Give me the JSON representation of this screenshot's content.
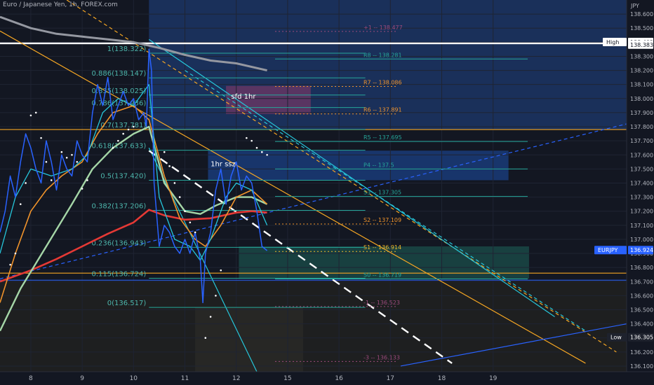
{
  "header": {
    "title": "Euro / Japanese Yen, 1h, FOREX.com"
  },
  "chart_data": {
    "type": "line",
    "axis": {
      "currency": "JPY",
      "y_ticks": [
        138.6,
        138.5,
        138.4,
        138.3,
        138.2,
        138.1,
        138.0,
        137.9,
        137.8,
        137.7,
        137.6,
        137.5,
        137.4,
        137.3,
        137.2,
        137.1,
        137.0,
        136.9,
        136.8,
        136.7,
        136.6,
        136.5,
        136.4,
        136.3,
        136.2,
        136.1
      ],
      "ylim": [
        136.06,
        138.7
      ],
      "x_ticks": [
        "8",
        "9",
        "10",
        "11",
        "12",
        "15",
        "16",
        "17",
        "18",
        "19"
      ],
      "xlim": [
        7.4,
        19.6
      ]
    },
    "markers": [
      {
        "label": "High",
        "value": "138.402",
        "y": 138.402,
        "color": "#ffffff",
        "text_color": "#131722"
      },
      {
        "label": "",
        "value": "138.383",
        "y": 138.383,
        "color": "#ffffff",
        "text_color": "#131722"
      },
      {
        "label": "EURJPY",
        "value": "136.924",
        "y": 136.924,
        "color": "#2962ff",
        "text_color": "#ffffff"
      },
      {
        "label": "Low",
        "value": "136.305",
        "y": 136.305,
        "color": "#1e222d",
        "text_color": "#ffffff"
      }
    ],
    "fib": {
      "x_start": 10.3,
      "x_end": 12.6,
      "levels": [
        {
          "ratio": "1",
          "price": "138.322",
          "y": 138.322
        },
        {
          "ratio": "0.886",
          "price": "138.147",
          "y": 138.147
        },
        {
          "ratio": "0.835",
          "price": "138.025",
          "y": 138.025
        },
        {
          "ratio": "0.786",
          "price": "137.936",
          "y": 137.936
        },
        {
          "ratio": "0.7",
          "price": "137.781",
          "y": 137.781
        },
        {
          "ratio": "0.618",
          "price": "137.633",
          "y": 137.633
        },
        {
          "ratio": "0.5",
          "price": "137.420",
          "y": 137.42
        },
        {
          "ratio": "0.382",
          "price": "137.206",
          "y": 137.206
        },
        {
          "ratio": "0.236",
          "price": "136.943",
          "y": 136.943
        },
        {
          "ratio": "0.115",
          "price": "136.724",
          "y": 136.724
        },
        {
          "ratio": "0",
          "price": "136.517",
          "y": 136.517
        }
      ]
    },
    "pivots": [
      {
        "label": "+1",
        "price": "138.477",
        "y": 138.477,
        "color": "#9c4a7c",
        "style": "dotted"
      },
      {
        "label": "R8",
        "price": "138.281",
        "y": 138.281,
        "color": "#26a69a",
        "style": "solid"
      },
      {
        "label": "R7",
        "price": "138.086",
        "y": 138.086,
        "color": "#f0932b",
        "style": "dotted"
      },
      {
        "label": "R6",
        "price": "137.891",
        "y": 137.891,
        "color": "#f0932b",
        "style": "dotted"
      },
      {
        "label": "R5",
        "price": "137.695",
        "y": 137.695,
        "color": "#26a69a",
        "style": "solid"
      },
      {
        "label": "P4",
        "price": "137.5",
        "y": 137.5,
        "color": "#26a69a",
        "style": "solid"
      },
      {
        "label": "S3",
        "price": "137.305",
        "y": 137.305,
        "color": "#26a69a",
        "style": "solid"
      },
      {
        "label": "S2",
        "price": "137.109",
        "y": 137.109,
        "color": "#f0932b",
        "style": "dotted"
      },
      {
        "label": "S1",
        "price": "136.914",
        "y": 136.914,
        "color": "#f0b429",
        "style": "dotted"
      },
      {
        "label": "S0",
        "price": "136.719",
        "y": 136.719,
        "color": "#26a69a",
        "style": "solid"
      },
      {
        "label": "-1",
        "price": "136.523",
        "y": 136.523,
        "color": "#9c4a7c",
        "style": "dotted"
      },
      {
        "label": "-3",
        "price": "136.133",
        "y": 136.133,
        "color": "#9c4a7c",
        "style": "dotted"
      }
    ],
    "annotations": [
      {
        "text": "sfd 1hr",
        "x": 11.9,
        "y": 138.0
      },
      {
        "text": "1hr ssz",
        "x": 11.5,
        "y": 137.52
      }
    ],
    "price_series": {
      "name": "",
      "color": "#2962ff",
      "x": [
        7.4,
        7.5,
        7.6,
        7.7,
        7.8,
        7.9,
        8.0,
        8.1,
        8.2,
        8.3,
        8.4,
        8.5,
        8.6,
        8.7,
        8.8,
        8.9,
        9.0,
        9.1,
        9.2,
        9.3,
        9.4,
        9.5,
        9.6,
        9.7,
        9.8,
        9.9,
        10.0,
        10.1,
        10.2,
        10.25,
        10.3,
        10.35,
        10.4,
        10.5,
        10.6,
        10.7,
        10.8,
        10.9,
        11.0,
        11.1,
        11.2,
        11.3,
        11.35,
        11.4,
        11.5,
        11.6,
        11.7,
        11.8,
        11.9,
        12.0,
        12.1,
        12.2,
        12.3,
        12.4,
        12.5,
        12.6
      ],
      "y": [
        137.05,
        137.2,
        137.45,
        137.3,
        137.55,
        137.75,
        137.65,
        137.5,
        137.4,
        137.7,
        137.55,
        137.35,
        137.6,
        137.5,
        137.45,
        137.7,
        137.6,
        137.55,
        137.9,
        138.1,
        137.95,
        138.15,
        137.85,
        137.95,
        138.05,
        137.95,
        138.0,
        137.85,
        137.9,
        137.8,
        138.35,
        138.2,
        137.4,
        136.95,
        137.1,
        137.05,
        136.95,
        136.9,
        137.0,
        136.9,
        137.05,
        136.85,
        136.55,
        136.9,
        137.05,
        137.35,
        137.5,
        137.25,
        137.45,
        137.55,
        137.35,
        137.45,
        137.4,
        137.2,
        136.95,
        136.92
      ]
    },
    "ema_slow": {
      "color": "#e53935",
      "x": [
        7.4,
        8.0,
        8.5,
        9.0,
        9.5,
        10.0,
        10.3,
        10.6,
        11.0,
        11.5,
        12.0,
        12.3,
        12.6
      ],
      "y": [
        136.7,
        136.78,
        136.86,
        136.95,
        137.04,
        137.12,
        137.21,
        137.17,
        137.14,
        137.15,
        137.19,
        137.2,
        137.19
      ]
    },
    "ema_mid": {
      "color": "#a5d6a7",
      "x": [
        7.4,
        7.8,
        8.3,
        8.8,
        9.2,
        9.6,
        10.0,
        10.3,
        10.6,
        11.0,
        11.3,
        11.6,
        12.0,
        12.3,
        12.6
      ],
      "y": [
        136.35,
        136.65,
        136.95,
        137.25,
        137.5,
        137.65,
        137.75,
        137.8,
        137.4,
        137.2,
        137.18,
        137.24,
        137.3,
        137.3,
        137.25
      ]
    },
    "ema_fast": {
      "color": "#f0932b",
      "x": [
        7.4,
        7.7,
        8.0,
        8.3,
        8.6,
        9.0,
        9.3,
        9.6,
        10.0,
        10.3,
        10.6,
        10.9,
        11.2,
        11.4,
        11.7,
        12.0,
        12.3,
        12.6
      ],
      "y": [
        136.55,
        136.9,
        137.2,
        137.35,
        137.45,
        137.55,
        137.75,
        137.9,
        137.95,
        137.85,
        137.45,
        137.15,
        137.0,
        136.95,
        137.1,
        137.3,
        137.35,
        137.25
      ]
    },
    "ema_cyan": {
      "color": "#26c6da",
      "x": [
        7.4,
        7.7,
        8.0,
        8.4,
        8.8,
        9.1,
        9.4,
        9.7,
        10.0,
        10.3,
        10.5,
        10.8,
        11.1,
        11.3,
        11.5,
        11.8,
        12.0,
        12.3,
        12.6
      ],
      "y": [
        136.9,
        137.3,
        137.5,
        137.45,
        137.5,
        137.6,
        137.9,
        138.0,
        137.95,
        138.1,
        137.3,
        137.0,
        136.95,
        136.85,
        137.0,
        137.3,
        137.4,
        137.35,
        137.1
      ]
    },
    "ma_grey": {
      "color": "#9598a1",
      "x": [
        7.4,
        8.0,
        8.5,
        9.0,
        9.5,
        10.0,
        10.5,
        11.0,
        11.5,
        12.0,
        12.6
      ],
      "y": [
        138.58,
        138.5,
        138.46,
        138.44,
        138.42,
        138.4,
        138.36,
        138.31,
        138.27,
        138.25,
        138.2
      ]
    },
    "psar": {
      "x": [
        7.6,
        7.7,
        7.8,
        7.9,
        8.0,
        8.1,
        8.2,
        8.3,
        8.4,
        8.6,
        8.7,
        8.8,
        8.9,
        9.0,
        9.1,
        9.6,
        9.7,
        9.8,
        9.9,
        10.0,
        10.6,
        10.7,
        10.8,
        10.9,
        11.0,
        11.1,
        11.2,
        11.4,
        11.5,
        11.6,
        11.7,
        12.2,
        12.3,
        12.4,
        12.5,
        12.6
      ],
      "y": [
        136.82,
        136.9,
        137.25,
        137.4,
        137.88,
        137.9,
        137.72,
        137.55,
        137.42,
        137.62,
        137.58,
        137.6,
        137.55,
        137.36,
        137.42,
        137.65,
        137.7,
        137.75,
        137.78,
        137.8,
        137.62,
        137.52,
        137.4,
        137.3,
        137.2,
        137.12,
        137.05,
        136.3,
        136.45,
        136.6,
        136.78,
        137.72,
        137.7,
        137.65,
        137.62,
        137.6
      ]
    },
    "trend_lines": [
      {
        "color": "#f5a623",
        "dash": false,
        "x": [
          7.4,
          18.8
        ],
        "y": [
          138.48,
          136.12
        ]
      },
      {
        "color": "#f5a623",
        "dash": true,
        "x": [
          8.7,
          19.4
        ],
        "y": [
          138.7,
          136.2
        ]
      },
      {
        "color": "#26c6da",
        "dash": false,
        "x": [
          10.3,
          18.2
        ],
        "y": [
          138.42,
          136.45
        ]
      },
      {
        "color": "#26c6da",
        "dash": true,
        "x": [
          11.0,
          18.8
        ],
        "y": [
          138.2,
          136.35
        ]
      },
      {
        "color": "#26c6da",
        "dash": false,
        "x": [
          10.3,
          12.4
        ],
        "y": [
          137.65,
          136.06
        ]
      },
      {
        "color": "#ffffff",
        "dash": true,
        "x": [
          10.3,
          16.2
        ],
        "y": [
          137.63,
          136.12
        ]
      },
      {
        "color": "#2962ff",
        "dash": true,
        "x": [
          7.4,
          19.6
        ],
        "y": [
          136.72,
          137.82
        ]
      },
      {
        "color": "#2962ff",
        "dash": false,
        "x": [
          15.2,
          19.6
        ],
        "y": [
          136.1,
          136.4
        ]
      }
    ],
    "hlines": [
      {
        "y": 138.392,
        "color": "#ffffff",
        "x_from": 7.4,
        "x_to": 19.6,
        "width": 2.4
      },
      {
        "y": 137.78,
        "color": "#f5a623",
        "x_from": 7.4,
        "x_to": 19.6,
        "width": 1.2
      },
      {
        "y": 136.76,
        "color": "#f5a623",
        "x_from": 7.4,
        "x_to": 19.6,
        "width": 1.2
      },
      {
        "y": 136.71,
        "color": "#2962ff",
        "x_from": 7.4,
        "x_to": 19.6,
        "width": 1.0
      }
    ],
    "zones": [
      {
        "x0": 10.3,
        "x1": 19.6,
        "y0": 137.78,
        "y1": 138.7,
        "color": "#1e3a6e",
        "opacity": 0.75
      },
      {
        "x0": 11.8,
        "x1": 13.45,
        "y0": 137.89,
        "y1": 138.09,
        "color": "#8e3b6a",
        "opacity": 0.55
      },
      {
        "x0": 11.45,
        "x1": 17.3,
        "y0": 137.42,
        "y1": 137.63,
        "color": "#1e4fa8",
        "opacity": 0.55
      },
      {
        "x0": 12.05,
        "x1": 17.7,
        "y0": 136.72,
        "y1": 136.95,
        "color": "#1d5b55",
        "opacity": 0.6
      },
      {
        "x0": 11.2,
        "x1": 13.3,
        "y0": 136.06,
        "y1": 136.52,
        "color": "#6e6a55",
        "opacity": 0.18
      },
      {
        "x0": 7.4,
        "x1": 19.6,
        "y0": 136.06,
        "y1": 136.71,
        "color": "#2d2a1f",
        "opacity": 0.45
      }
    ]
  }
}
